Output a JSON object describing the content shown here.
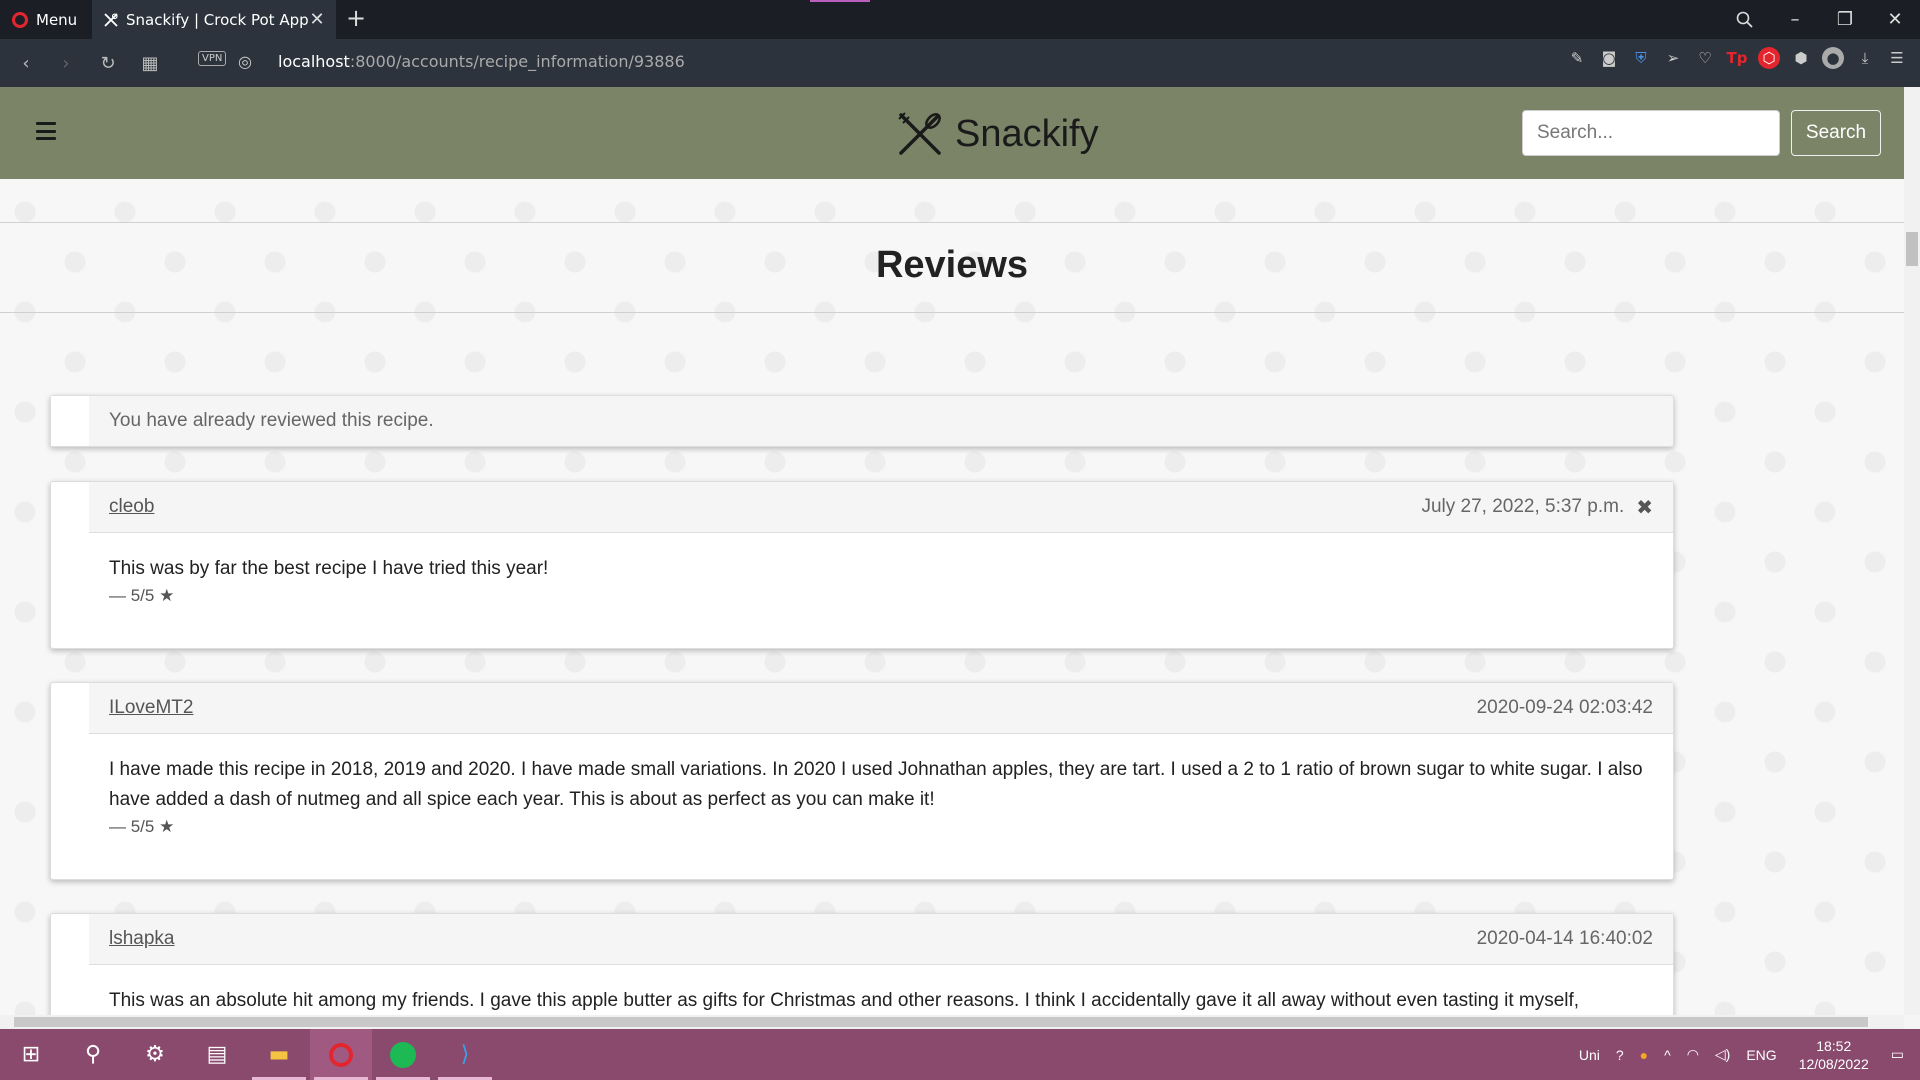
{
  "browser": {
    "menu_label": "Menu",
    "tab_title": "Snackify | Crock Pot Apple",
    "url_host": "localhost",
    "url_rest": ":8000/accounts/recipe_information/93886",
    "vpn_label": "VPN"
  },
  "site": {
    "brand": "Snackify",
    "search_placeholder": "Search...",
    "search_button": "Search"
  },
  "page": {
    "heading": "Reviews",
    "notice": "You have already reviewed this recipe."
  },
  "reviews": [
    {
      "user": "cleob",
      "date": "July 27, 2022, 5:37 p.m.",
      "text": "This was by far the best recipe I have tried this year!",
      "rating": "— 5/5",
      "deletable": true
    },
    {
      "user": "ILoveMT2",
      "date": "2020-09-24 02:03:42",
      "text": "I have made this recipe in 2018, 2019 and 2020. I have made small variations. In 2020 I used Johnathan apples, they are tart. I used a 2 to 1 ratio of brown sugar to white sugar. I also have added a dash of nutmeg and all spice each year. This is about as perfect as you can make it!",
      "rating": "— 5/5"
    },
    {
      "user": "lshapka",
      "date": "2020-04-14 16:40:02",
      "text": "This was an absolute hit among my friends. I gave this apple butter as gifts for Christmas and other reasons. I think I accidentally gave it all away without even tasting it myself,"
    }
  ],
  "taskbar": {
    "lang_short": "Uni",
    "lang": "ENG",
    "time": "18:52",
    "date": "12/08/2022"
  },
  "colors": {
    "navbar": "#7b8467",
    "taskbar": "#8a4a6e",
    "browser_dark": "#1b1f25"
  }
}
